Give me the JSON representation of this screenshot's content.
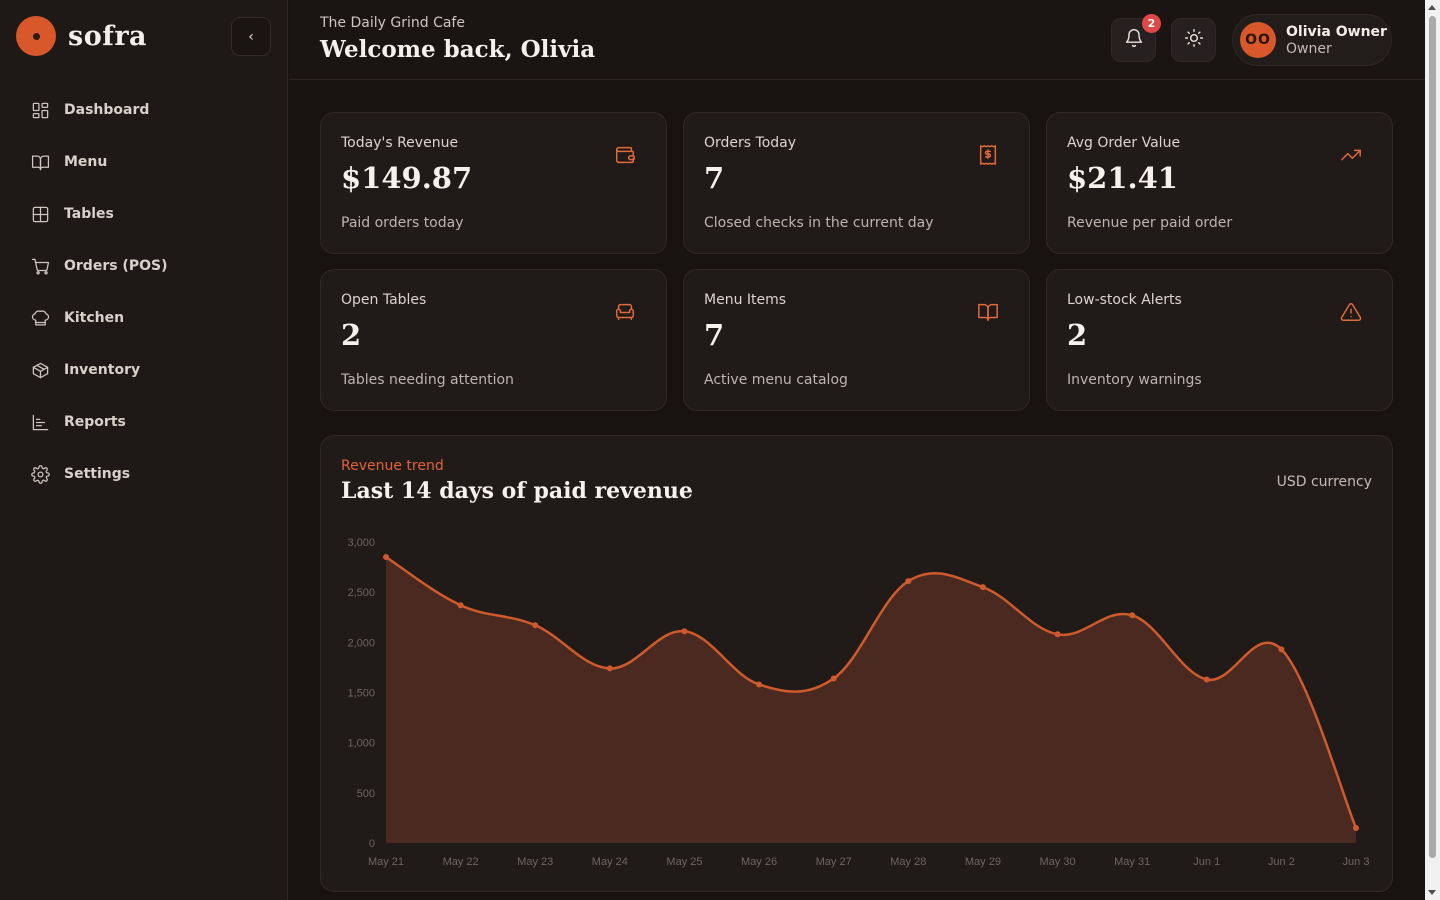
{
  "brand": {
    "name": "sofra",
    "logo_icon": "logo-dot-icon"
  },
  "sidebar": {
    "collapse_label": "‹",
    "items": [
      {
        "label": "Dashboard",
        "icon": "dashboard-icon"
      },
      {
        "label": "Menu",
        "icon": "book-icon"
      },
      {
        "label": "Tables",
        "icon": "grid-icon"
      },
      {
        "label": "Orders (POS)",
        "icon": "cart-icon"
      },
      {
        "label": "Kitchen",
        "icon": "chef-hat-icon"
      },
      {
        "label": "Inventory",
        "icon": "package-icon"
      },
      {
        "label": "Reports",
        "icon": "bar-chart-icon"
      },
      {
        "label": "Settings",
        "icon": "gear-icon"
      }
    ]
  },
  "header": {
    "cafe_name": "The Daily Grind Cafe",
    "welcome": "Welcome back, Olivia",
    "notification_count": "2",
    "user": {
      "initials": "OO",
      "name": "Olivia Owner",
      "role": "Owner"
    }
  },
  "stats": [
    {
      "title": "Today's Revenue",
      "value": "$149.87",
      "sub": "Paid orders today",
      "icon": "wallet-icon"
    },
    {
      "title": "Orders Today",
      "value": "7",
      "sub": "Closed checks in the current day",
      "icon": "receipt-icon"
    },
    {
      "title": "Avg Order Value",
      "value": "$21.41",
      "sub": "Revenue per paid order",
      "icon": "trending-up-icon"
    },
    {
      "title": "Open Tables",
      "value": "2",
      "sub": "Tables needing attention",
      "icon": "armchair-icon"
    },
    {
      "title": "Menu Items",
      "value": "7",
      "sub": "Active menu catalog",
      "icon": "book-open-icon"
    },
    {
      "title": "Low-stock Alerts",
      "value": "2",
      "sub": "Inventory warnings",
      "icon": "alert-triangle-icon"
    }
  ],
  "chart_panel": {
    "eyebrow": "Revenue trend",
    "title": "Last 14 days of paid revenue",
    "currency": "USD currency"
  },
  "colors": {
    "accent": "#d8582c",
    "line": "#cf5a2c",
    "area": "#4a2a20",
    "badge": "#e04848"
  },
  "chart_data": {
    "type": "area",
    "categories": [
      "May 21",
      "May 22",
      "May 23",
      "May 24",
      "May 25",
      "May 26",
      "May 27",
      "May 28",
      "May 29",
      "May 30",
      "May 31",
      "Jun 1",
      "Jun 2",
      "Jun 3"
    ],
    "values": [
      2850,
      2370,
      2170,
      1740,
      2110,
      1580,
      1640,
      2610,
      2550,
      2080,
      2270,
      1630,
      1930,
      150
    ],
    "yticks": [
      0,
      500,
      1000,
      1500,
      2000,
      2500,
      3000
    ],
    "ylim": [
      0,
      3000
    ],
    "title": "Last 14 days of paid revenue",
    "xlabel": "",
    "ylabel": "",
    "grid": false
  }
}
